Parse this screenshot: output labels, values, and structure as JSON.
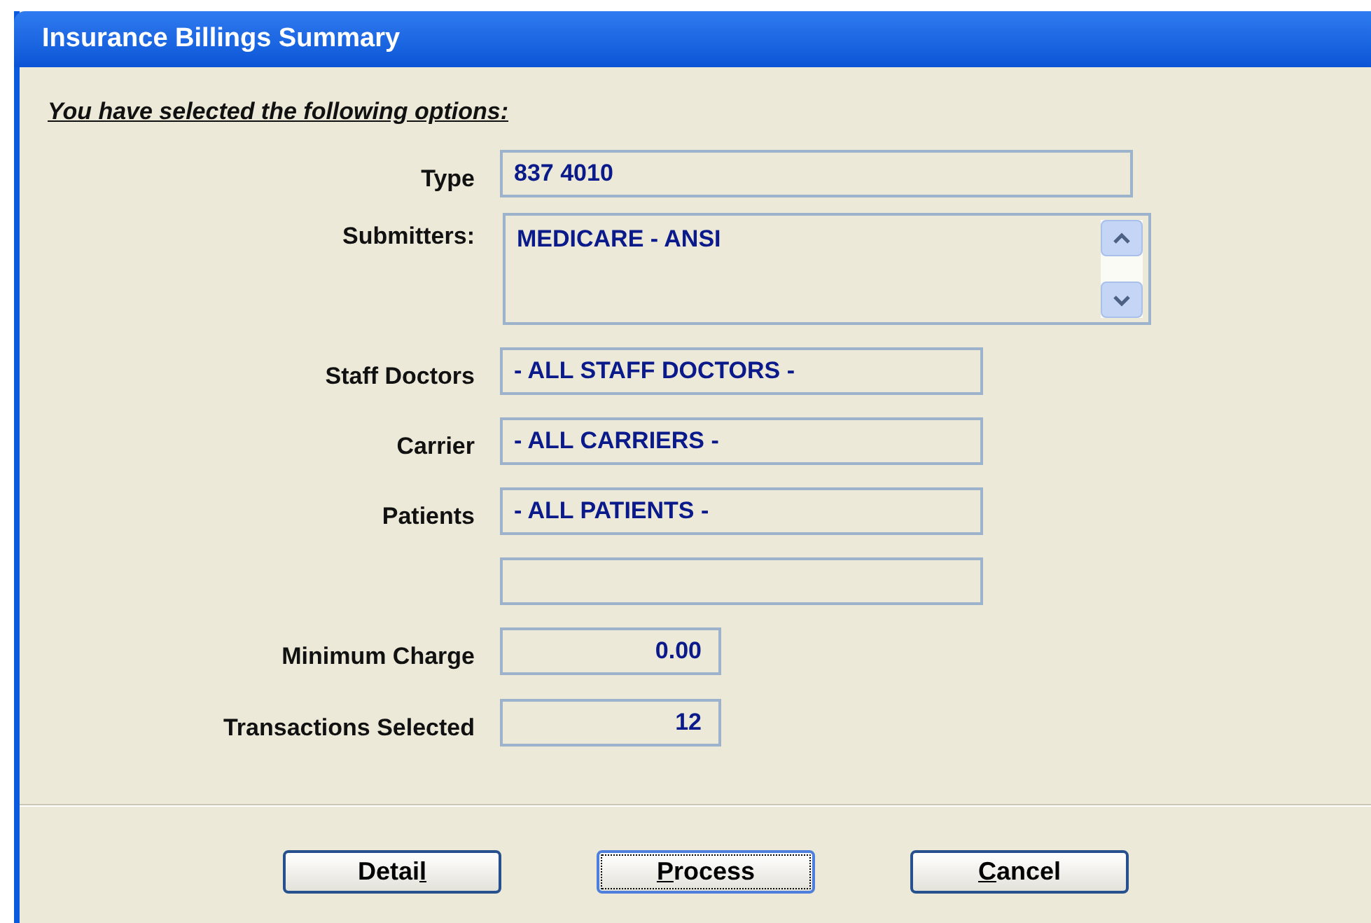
{
  "window": {
    "title": "Insurance Billings Summary"
  },
  "heading": "You have selected the following options:",
  "fields": [
    {
      "kind": "text",
      "label": "Type",
      "value": "837 4010"
    },
    {
      "kind": "list",
      "label": "Submitters:",
      "value": "MEDICARE - ANSI"
    },
    {
      "kind": "text",
      "label": "Staff Doctors",
      "value": "- ALL STAFF DOCTORS -"
    },
    {
      "kind": "text",
      "label": "Carrier",
      "value": "- ALL CARRIERS -"
    },
    {
      "kind": "text",
      "label": "Patients",
      "value": "- ALL PATIENTS -"
    },
    {
      "kind": "blank"
    },
    {
      "kind": "number",
      "label": "Minimum Charge",
      "value": "0.00"
    },
    {
      "kind": "number",
      "label": "Transactions Selected",
      "value": "12"
    }
  ],
  "buttons": [
    {
      "pre": "Detai",
      "key": "l",
      "focused": false
    },
    {
      "key": "P",
      "post": "rocess",
      "focused": true
    },
    {
      "key": "C",
      "post": "ancel",
      "focused": false
    }
  ]
}
